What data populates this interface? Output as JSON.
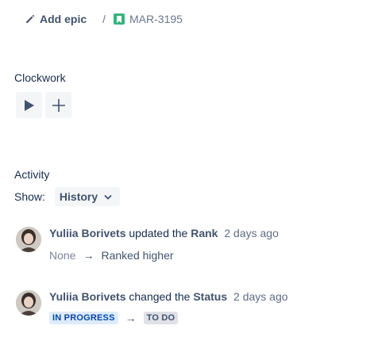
{
  "breadcrumb": {
    "add_epic_label": "Add epic",
    "separator": "/",
    "issue_key": "MAR-3195",
    "story_color": "#36b37e"
  },
  "clockwork": {
    "title": "Clockwork",
    "buttons": [
      {
        "icon": "play-icon"
      },
      {
        "icon": "plus-icon"
      }
    ]
  },
  "activity": {
    "title": "Activity",
    "show_label": "Show:",
    "filter_value": "History",
    "entries": [
      {
        "user": "Yuliia Borivets",
        "verb": "updated the",
        "field": "Rank",
        "time": "2 days ago",
        "from": "None",
        "arrow": "→",
        "to": "Ranked higher"
      },
      {
        "user": "Yuliia Borivets",
        "verb": "changed the",
        "field": "Status",
        "time": "2 days ago",
        "from": "IN PROGRESS",
        "arrow": "→",
        "to": "TO DO"
      }
    ]
  },
  "colors": {
    "in_progress_bg": "#deebff",
    "in_progress_text": "#0747a6",
    "todo_bg": "#dfe1e6",
    "todo_text": "#42526e"
  }
}
